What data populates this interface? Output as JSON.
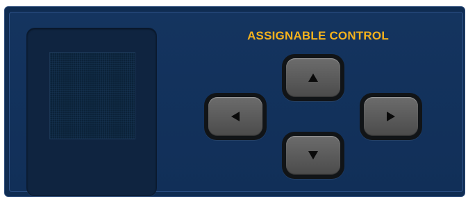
{
  "panel": {
    "title": "ASSIGNABLE CONTROL",
    "colors": {
      "title": "#f5b21c",
      "panel_background": "#14345f",
      "button_face": "#5a5a5a",
      "button_rim": "#111417"
    }
  },
  "display": {
    "screen_content": ""
  },
  "buttons": {
    "up": {
      "icon": "triangle-up-icon"
    },
    "down": {
      "icon": "triangle-down-icon"
    },
    "left": {
      "icon": "triangle-left-icon"
    },
    "right": {
      "icon": "triangle-right-icon"
    }
  }
}
